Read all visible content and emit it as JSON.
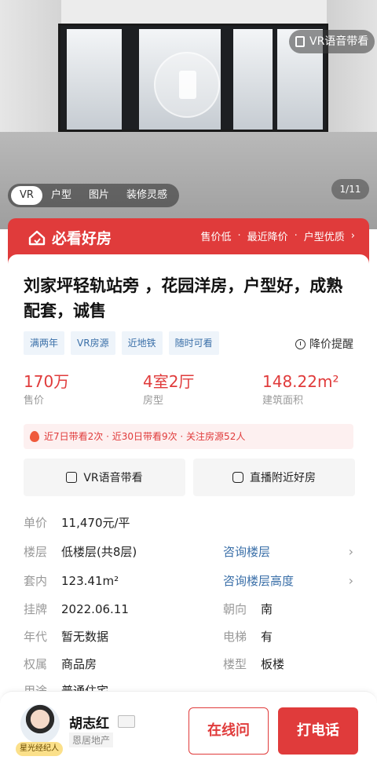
{
  "hero": {
    "vr_badge": "VR语音带看",
    "counter": "1/11",
    "tabs": [
      "VR",
      "户型",
      "图片",
      "装修灵感"
    ],
    "active_tab": "VR"
  },
  "banner": {
    "brand": "必看好房",
    "tags": [
      "售价低",
      "最近降价",
      "户型优质"
    ]
  },
  "listing": {
    "title": "刘家坪轻轨站旁 ，花园洋房，户型好，成熟配套，诚售",
    "badges": [
      "满两年",
      "VR房源",
      "近地铁",
      "随时可看"
    ],
    "price_alert": "降价提醒",
    "stats": [
      {
        "value": "170万",
        "label": "售价"
      },
      {
        "value": "4室2厅",
        "label": "房型"
      },
      {
        "value": "148.22m²",
        "label": "建筑面积"
      }
    ],
    "heat": "近7日带看2次 · 近30日带看9次 · 关注房源52人",
    "actions": [
      "VR语音带看",
      "直播附近好房"
    ]
  },
  "details": {
    "unit_price": {
      "label": "单价",
      "value": "11,470元/平"
    },
    "floor": {
      "label": "楼层",
      "value": "低楼层(共8层)",
      "link": "咨询楼层"
    },
    "inner": {
      "label": "套内",
      "value": "123.41m²",
      "link": "咨询楼层高度"
    },
    "listed": {
      "label": "挂牌",
      "value": "2022.06.11",
      "label2": "朝向",
      "value2": "南"
    },
    "year": {
      "label": "年代",
      "value": "暂无数据",
      "label2": "电梯",
      "value2": "有"
    },
    "ownership": {
      "label": "权属",
      "value": "商品房",
      "label2": "楼型",
      "value2": "板楼"
    },
    "usage": {
      "label": "用途",
      "value": "普通住宅"
    }
  },
  "agent": {
    "name": "胡志红",
    "company": "恩居地产",
    "badge": "星光经纪人",
    "online_label": "在线问",
    "call_label": "打电话"
  },
  "colors": {
    "accent": "#e03b3b",
    "link": "#3a6fa8"
  }
}
